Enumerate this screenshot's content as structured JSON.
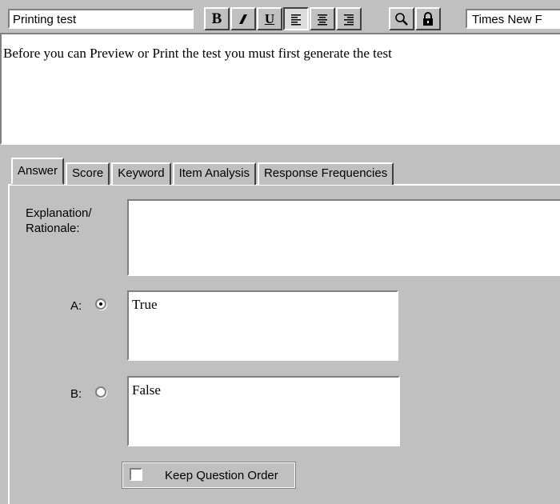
{
  "toolbar": {
    "title_value": "Printing test",
    "bold_label": "B",
    "italic_label": "I",
    "underline_label": "U",
    "font_value": "Times New F",
    "icons": [
      "bold-icon",
      "italic-icon",
      "underline-icon",
      "align-left-icon",
      "align-center-icon",
      "align-right-icon",
      "magnifier-icon",
      "lock-icon"
    ]
  },
  "question": {
    "text": "Before you can Preview or Print the test you must first generate the test"
  },
  "tabs": [
    {
      "label": "Answer",
      "active": true
    },
    {
      "label": "Score",
      "active": false
    },
    {
      "label": "Keyword",
      "active": false
    },
    {
      "label": "Item Analysis",
      "active": false
    },
    {
      "label": "Response Frequencies",
      "active": false
    }
  ],
  "answer_panel": {
    "explanation_label_line1": "Explanation/",
    "explanation_label_line2": "Rationale:",
    "explanation_value": "",
    "choices": [
      {
        "letter": "A:",
        "selected": true,
        "text": "True"
      },
      {
        "letter": "B:",
        "selected": false,
        "text": "False"
      }
    ],
    "keep_order_label": "Keep Question Order",
    "keep_order_checked": false
  }
}
